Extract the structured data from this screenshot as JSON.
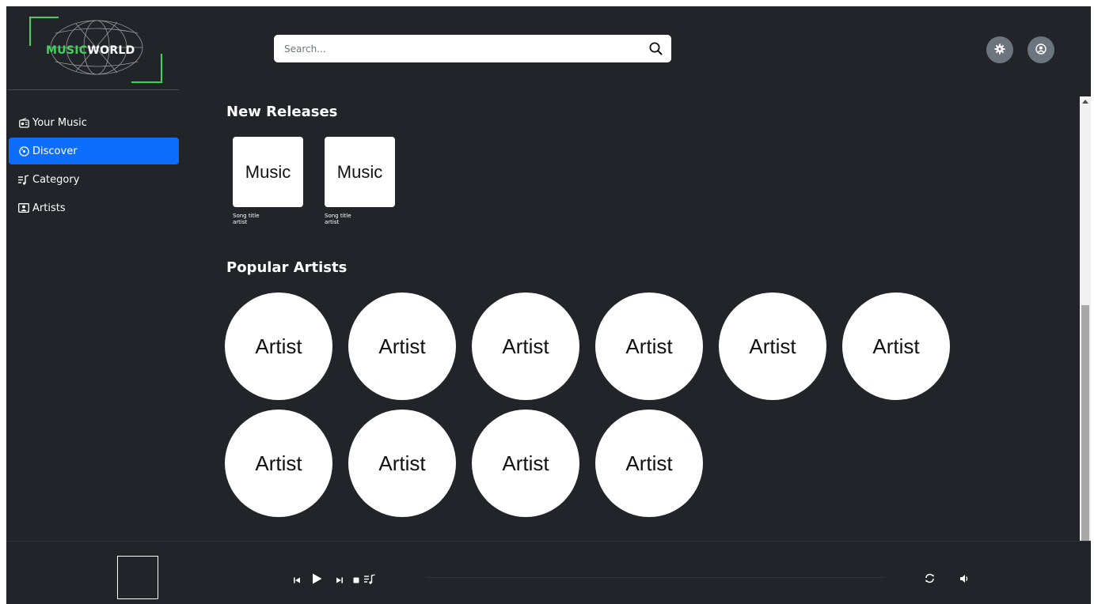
{
  "app": {
    "brand_part1": "MUSIC",
    "brand_part2": "WORLD",
    "accent_color": "#0d6efd",
    "brand_accent_color": "#3fd35b",
    "background_color": "#212529"
  },
  "header": {
    "search_placeholder": "Search...",
    "search_icon": "search-icon",
    "settings_icon": "gear-icon",
    "profile_icon": "user-circle-icon"
  },
  "sidebar": {
    "items": [
      {
        "label": "Your Music",
        "icon": "radio-icon",
        "active": false
      },
      {
        "label": "Discover",
        "icon": "disc-icon",
        "active": true
      },
      {
        "label": "Category",
        "icon": "music-list-icon",
        "active": false
      },
      {
        "label": "Artists",
        "icon": "person-card-icon",
        "active": false
      }
    ]
  },
  "main": {
    "new_releases": {
      "title": "New Releases",
      "items": [
        {
          "cover": "Music",
          "song": "Song title",
          "artist": "artist"
        },
        {
          "cover": "Music",
          "song": "Song title",
          "artist": "artist"
        }
      ]
    },
    "popular_artists": {
      "title": "Popular Artists",
      "items": [
        "Artist",
        "Artist",
        "Artist",
        "Artist",
        "Artist",
        "Artist",
        "Artist",
        "Artist",
        "Artist",
        "Artist"
      ]
    }
  },
  "player": {
    "controls": [
      "previous-icon",
      "play-icon",
      "next-icon",
      "stop-icon",
      "playlist-icon"
    ],
    "right_controls": [
      "repeat-icon",
      "volume-icon"
    ]
  }
}
